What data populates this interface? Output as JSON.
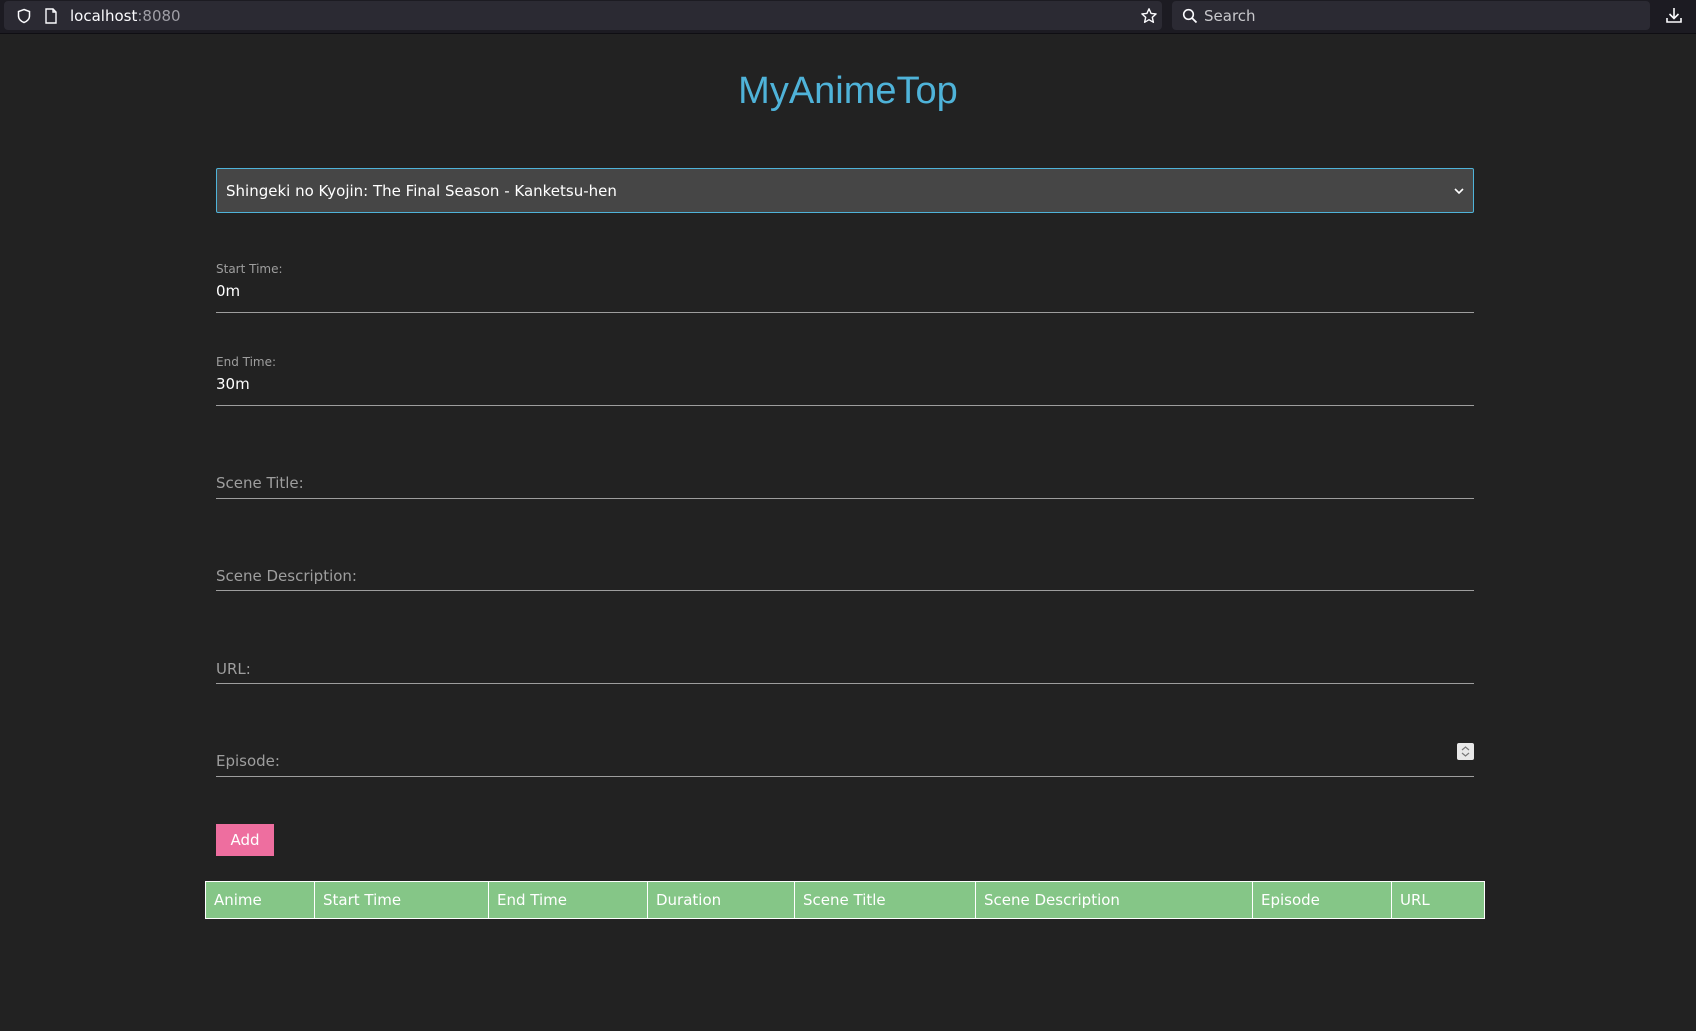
{
  "browser": {
    "url_host": "localhost",
    "url_port": ":8080",
    "search_placeholder": "Search"
  },
  "app": {
    "title": "MyAnimeTop"
  },
  "form": {
    "anime_select": {
      "selected": "Shingeki no Kyojin: The Final Season - Kanketsu-hen"
    },
    "start_time": {
      "label": "Start Time:",
      "value": "0m"
    },
    "end_time": {
      "label": "End Time:",
      "value": "30m"
    },
    "scene_title": {
      "placeholder": "Scene Title:"
    },
    "scene_description": {
      "placeholder": "Scene Description:"
    },
    "url": {
      "placeholder": "URL:"
    },
    "episode": {
      "placeholder": "Episode:"
    },
    "add_label": "Add"
  },
  "table": {
    "headers": [
      "Anime",
      "Start Time",
      "End Time",
      "Duration",
      "Scene Title",
      "Scene Description",
      "Episode",
      "URL"
    ]
  },
  "colors": {
    "accent": "#4fb3d9",
    "add_button": "#ee6e9f",
    "table_header": "#85c687",
    "background": "#222222"
  },
  "icons": [
    "shield-icon",
    "page-icon",
    "star-icon",
    "search-icon",
    "download-icon",
    "chevron-down-icon",
    "spinner-icon"
  ]
}
